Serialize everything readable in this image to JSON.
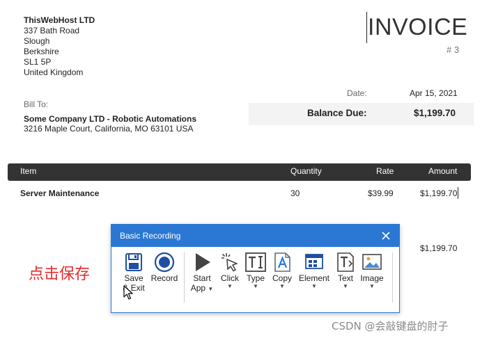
{
  "company": {
    "name": "ThisWebHost LTD",
    "address_lines": [
      "337 Bath Road",
      "Slough",
      "Berkshire",
      "SL1 5P",
      "United Kingdom"
    ]
  },
  "invoice": {
    "title": "INVOICE",
    "number": "# 3",
    "date_label": "Date:",
    "date_value": "Apr 15, 2021",
    "balance_label": "Balance Due:",
    "balance_value": "$1,199.70"
  },
  "bill_to": {
    "label": "Bill To:",
    "name": "Some Company LTD - Robotic Automations",
    "address": "3216 Maple Court, California, MO 63101 USA"
  },
  "items_table": {
    "headers": [
      "Item",
      "Quantity",
      "Rate",
      "Amount"
    ],
    "rows": [
      {
        "item": "Server Maintenance",
        "quantity": "30",
        "rate": "$39.99",
        "amount": "$1,199.70"
      }
    ],
    "subtotal": "$1,199.70"
  },
  "annotation": "点击保存",
  "dialog": {
    "title": "Basic Recording",
    "tools": [
      {
        "icon": "save-icon",
        "label_line1": "Save",
        "label_line2": "& Exit"
      },
      {
        "icon": "record-icon",
        "label_line1": "Record",
        "label_line2": ""
      },
      {
        "icon": "play-icon",
        "label_line1": "Start",
        "label_line2": "App"
      },
      {
        "icon": "click-icon",
        "label_line1": "Click",
        "label_line2": ""
      },
      {
        "icon": "type-icon",
        "label_line1": "Type",
        "label_line2": ""
      },
      {
        "icon": "copy-icon",
        "label_line1": "Copy",
        "label_line2": ""
      },
      {
        "icon": "element-icon",
        "label_line1": "Element",
        "label_line2": ""
      },
      {
        "icon": "text-icon",
        "label_line1": "Text",
        "label_line2": ""
      },
      {
        "icon": "image-icon",
        "label_line1": "Image",
        "label_line2": ""
      }
    ]
  },
  "watermark": "CSDN @会敲键盘的肘子",
  "colors": {
    "dialog_accent": "#2a78d4",
    "header_bar": "#333333",
    "annotation": "#e52b2b"
  }
}
